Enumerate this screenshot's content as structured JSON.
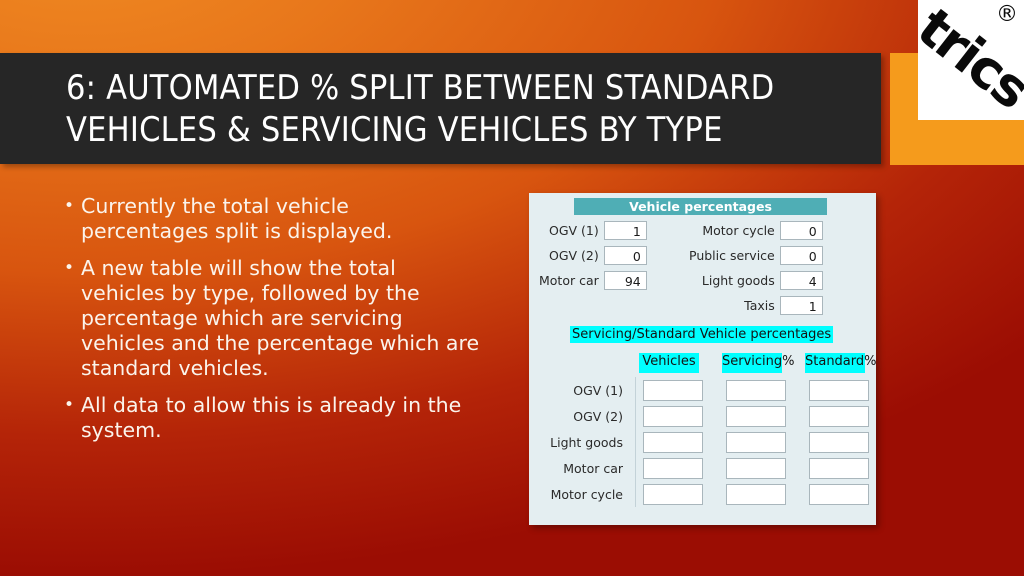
{
  "slide": {
    "title": "6: AUTOMATED % SPLIT BETWEEN STANDARD\nVEHICLES & SERVICING VEHICLES BY TYPE",
    "background_start": "#F08A22",
    "background_end": "#9B0D03",
    "title_bar_color": "#262626"
  },
  "logo": {
    "wordmark": "trics",
    "registered_mark": "®",
    "block_color": "#F59B1C",
    "tile_color": "#FFFFFF"
  },
  "bullets": [
    "Currently the total vehicle percentages split is displayed.",
    "A new table will show the total vehicles by type, followed by the percentage which are servicing vehicles and the percentage which are standard vehicles.",
    "All data to allow this is already in the system."
  ],
  "app": {
    "panel_background": "#E4EEF1",
    "header_color": "#4FAEB5",
    "highlight_color": "#00FFFF",
    "vehicle_percentages": {
      "header": "Vehicle percentages",
      "left_column": [
        {
          "label": "OGV (1)",
          "value": "1"
        },
        {
          "label": "OGV (2)",
          "value": "0"
        },
        {
          "label": "Motor car",
          "value": "94"
        }
      ],
      "right_column": [
        {
          "label": "Motor cycle",
          "value": "0"
        },
        {
          "label": "Public service",
          "value": "0"
        },
        {
          "label": "Light goods",
          "value": "4"
        },
        {
          "label": "Taxis",
          "value": "1"
        }
      ]
    },
    "servicing_standard": {
      "header": "Servicing/Standard Vehicle percentages",
      "columns": [
        "Vehicles",
        "Servicing%",
        "Standard%"
      ],
      "rows": [
        {
          "label": "OGV (1)",
          "cells": [
            "",
            "",
            ""
          ]
        },
        {
          "label": "OGV (2)",
          "cells": [
            "",
            "",
            ""
          ]
        },
        {
          "label": "Light goods",
          "cells": [
            "",
            "",
            ""
          ]
        },
        {
          "label": "Motor car",
          "cells": [
            "",
            "",
            ""
          ]
        },
        {
          "label": "Motor cycle",
          "cells": [
            "",
            "",
            ""
          ]
        }
      ]
    }
  }
}
